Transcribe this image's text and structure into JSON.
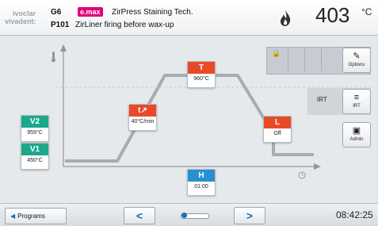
{
  "header": {
    "logo_line1": "ivoclar",
    "logo_line2": "vivadent:",
    "program_code": "G6",
    "brand": "e.max",
    "program_title": "ZirPress Staining Tech.",
    "program_number": "P101",
    "program_description": "ZirLiner firing before wax-up",
    "temperature": "403",
    "temperature_unit": "°C"
  },
  "chart": {
    "points": {
      "v2": {
        "label": "V2",
        "value": "959°C"
      },
      "v1": {
        "label": "V1",
        "value": "450°C"
      },
      "t_rate": {
        "label": "t↗",
        "value": "40°C/min"
      },
      "T": {
        "label": "T",
        "value": "960°C"
      },
      "L": {
        "label": "L",
        "value": "Off"
      },
      "H": {
        "label": "H",
        "value": "01:00"
      }
    }
  },
  "sidebar": {
    "options_label": "Options",
    "irt_text": "IRT",
    "irt_button_label": "IRT",
    "admin_label": "Admin"
  },
  "footer": {
    "programs_label": "Programs",
    "prev_arrow": "<",
    "next_arrow": ">",
    "time": "08:42:25"
  }
}
